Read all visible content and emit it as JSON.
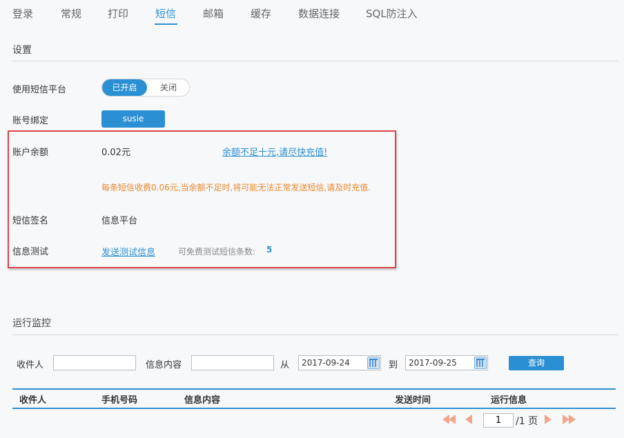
{
  "tabs": [
    "登录",
    "常规",
    "打印",
    "短信",
    "邮箱",
    "缓存",
    "数据连接",
    "SQL防注入"
  ],
  "active_tab": "短信",
  "settings": {
    "title": "设置",
    "sms_platform_label": "使用短信平台",
    "toggle_on": "已开启",
    "toggle_off": "关闭",
    "account_label": "账号绑定",
    "account_value": "susie",
    "balance_label": "账户余额",
    "balance_value": "0.02元",
    "balance_link": "余额不足十元,请尽快充值!",
    "fee_warning": "每条短信收费0.06元,当余额不足时,将可能无法正常发送短信,请及时充值.",
    "signature_label": "短信签名",
    "signature_value": "信息平台",
    "test_label": "信息测试",
    "test_link": "发送测试信息",
    "free_test_label": "可免费测试短信条数:",
    "free_test_count": "5"
  },
  "monitor": {
    "title": "运行监控",
    "recipient_label": "收件人",
    "content_label": "信息内容",
    "from_label": "从",
    "date_from": "2017-09-24",
    "to_label": "到",
    "date_to": "2017-09-25",
    "query_button": "查询",
    "columns": [
      "收件人",
      "手机号码",
      "信息内容",
      "发送时间",
      "运行信息"
    ]
  },
  "pager": {
    "current_page": "1",
    "total_text": "/1 页"
  },
  "colors": {
    "accent": "#2b8fd3",
    "warning": "#e8862a",
    "highlight_box": "#e0444b"
  }
}
